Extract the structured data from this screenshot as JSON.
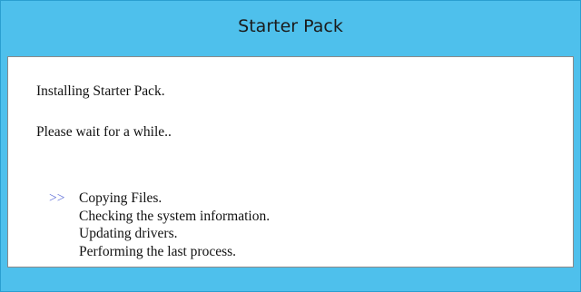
{
  "window": {
    "title": "Starter Pack",
    "accent_color": "#4ec0ec"
  },
  "content": {
    "message_line1": "Installing Starter Pack.",
    "message_line2": "Please wait for a while.."
  },
  "progress": {
    "current_marker": ">>",
    "current_step_index": 0,
    "steps": [
      {
        "label": "Copying Files."
      },
      {
        "label": "Checking the system information."
      },
      {
        "label": "Updating drivers."
      },
      {
        "label": "Performing the last process."
      }
    ]
  }
}
